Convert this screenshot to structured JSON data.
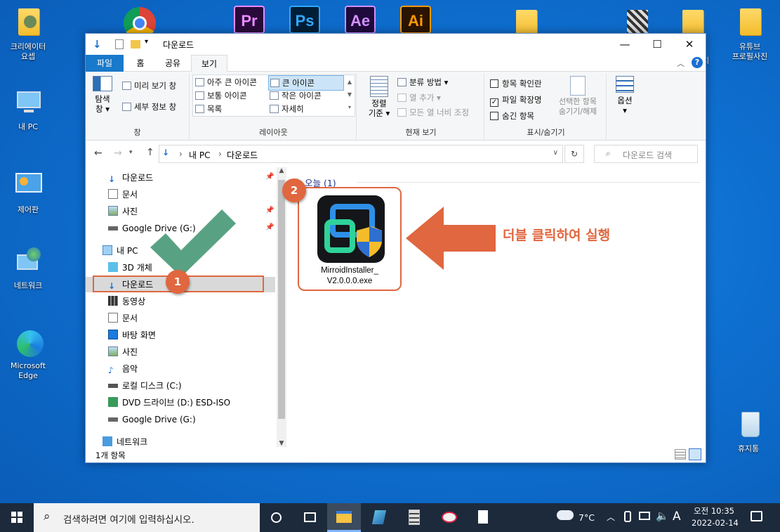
{
  "desktop": {
    "icons_left": [
      "크리에이터\n요셉",
      "내 PC",
      "제어판",
      "네트워크",
      "Microsoft\nEdge"
    ],
    "top_apps": [
      {
        "label": "Pr",
        "bg": "#2a0a3a",
        "fg": "#e98cff"
      },
      {
        "label": "Ps",
        "bg": "#001e36",
        "fg": "#31a8ff"
      },
      {
        "label": "Ae",
        "bg": "#1f0a3c",
        "fg": "#d291ff"
      },
      {
        "label": "Ai",
        "bg": "#2b1400",
        "fg": "#ff9a00"
      }
    ],
    "right_icons": [
      "지",
      "유튜브\n프로필사진",
      "휴지통"
    ]
  },
  "window": {
    "title": "다운로드",
    "tabs": [
      "파일",
      "홈",
      "공유",
      "보기"
    ],
    "ribbon": {
      "pane": {
        "nav_pane": "탐색\n창 ▾",
        "preview": "미리 보기 창",
        "details": "세부 정보 창",
        "label": "창"
      },
      "layout": {
        "items": [
          "아주 큰 아이콘",
          "큰 아이콘",
          "보통 아이콘",
          "작은 아이콘",
          "목록",
          "자세히"
        ],
        "label": "레이아웃"
      },
      "current_view": {
        "sort": "정렬\n기준 ▾",
        "group_by": "분류 방법 ▾",
        "add_column": "열 추가 ▾",
        "fit_columns": "모든 열 너비 조정",
        "label": "현재 보기"
      },
      "show_hide": {
        "item_checkbox": "항목 확인란",
        "file_ext": "파일 확장명",
        "hidden_items": "숨긴 항목",
        "hide_selected": "선택한 항목\n숨기기/해제",
        "label": "표시/숨기기"
      },
      "options": "옵션\n▾"
    },
    "address": {
      "pc": "내 PC",
      "folder": "다운로드",
      "search_placeholder": "다운로드 검색"
    },
    "nav": {
      "quick": [
        "다운로드",
        "문서",
        "사진",
        "Google Drive (G:)"
      ],
      "pc": "내 PC",
      "pc_items": [
        "3D 개체",
        "다운로드",
        "동영상",
        "문서",
        "바탕 화면",
        "사진",
        "음악",
        "로컬 디스크 (C:)",
        "DVD 드라이브 (D:) ESD-ISO",
        "Google Drive (G:)"
      ],
      "network": "네트워크"
    },
    "content": {
      "group_header": "오늘 (1)",
      "file_name": "MirroidInstaller_\nV2.0.0.0.exe"
    },
    "status": "1개 항목"
  },
  "annotations": {
    "step1": "1",
    "step2": "2",
    "instruction": "더블 클릭하여 실행",
    "accent": "#e0673f"
  },
  "taskbar": {
    "search_placeholder": "검색하려면 여기에 입력하십시오.",
    "weather": "7°C",
    "ime": "A",
    "time": "오전 10:35",
    "date": "2022-02-14"
  }
}
